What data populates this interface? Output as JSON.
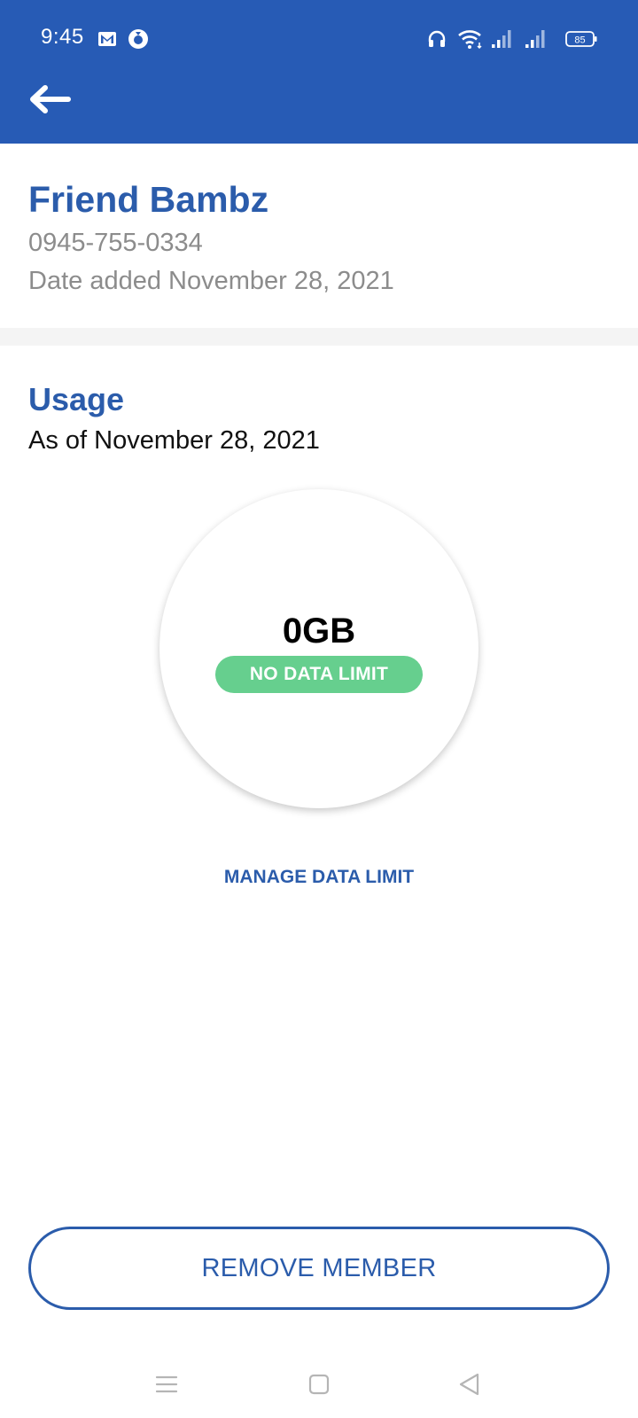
{
  "status_bar": {
    "time": "9:45",
    "battery": "85",
    "icons": [
      "gmail-icon",
      "messenger-icon",
      "headset-icon",
      "wifi-icon",
      "signal-icon",
      "signal-icon",
      "battery-icon"
    ]
  },
  "header": {
    "back_icon": "arrow-left-icon",
    "color": "#275bb5"
  },
  "member": {
    "name": "Friend Bambz",
    "phone": "0945-755-0334",
    "date_added": "Date added November 28, 2021"
  },
  "usage": {
    "title": "Usage",
    "as_of": "As of November 28, 2021",
    "value": "0GB",
    "limit_badge": "NO DATA LIMIT",
    "badge_color": "#66cf8e",
    "manage_link": "MANAGE DATA LIMIT"
  },
  "actions": {
    "remove_label": "REMOVE MEMBER"
  },
  "nav_bar": {
    "icons": [
      "menu-icon",
      "home-icon",
      "back-triangle-icon"
    ]
  },
  "colors": {
    "accent": "#2b5cab",
    "muted_text": "#8c8c8c"
  }
}
